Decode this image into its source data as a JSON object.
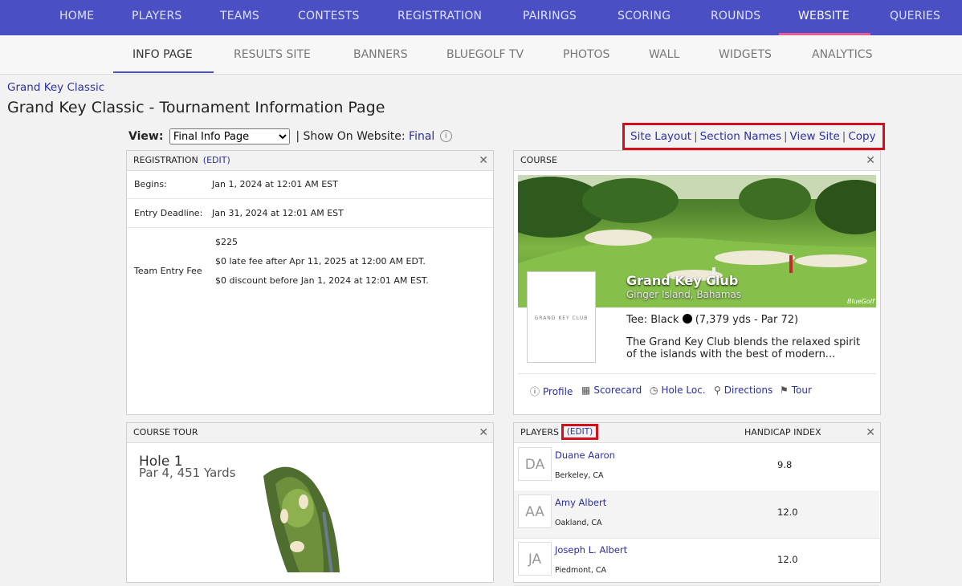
{
  "topnav": {
    "items": [
      "HOME",
      "PLAYERS",
      "TEAMS",
      "CONTESTS",
      "REGISTRATION",
      "PAIRINGS",
      "SCORING",
      "ROUNDS",
      "WEBSITE",
      "QUERIES"
    ],
    "active": "WEBSITE"
  },
  "subnav": {
    "items": [
      "INFO PAGE",
      "RESULTS SITE",
      "BANNERS",
      "BLUEGOLF TV",
      "PHOTOS",
      "WALL",
      "WIDGETS",
      "ANALYTICS"
    ],
    "active": "INFO PAGE"
  },
  "breadcrumb": "Grand Key Classic",
  "page_title": "Grand Key Classic - Tournament Information Page",
  "view": {
    "label": "View:",
    "selected": "Final Info Page",
    "separator": "|",
    "show_label": "Show On Website:",
    "show_value": "Final",
    "info_glyph": "i"
  },
  "actions": [
    "Site Layout",
    "Section Names",
    "View Site",
    "Copy"
  ],
  "action_separator": "|",
  "registration": {
    "title": "REGISTRATION",
    "edit": "(EDIT)",
    "begins_label": "Begins:",
    "begins_value": "Jan 1, 2024 at 12:01 AM EST",
    "deadline_label": "Entry Deadline:",
    "deadline_value": "Jan 31, 2024 at 12:01 AM EST",
    "fee_label": "Team Entry Fee",
    "fee_lines": [
      "$225",
      "$0 late fee after Apr 11, 2025 at 12:00 AM EDT.",
      "$0 discount before Jan 1, 2024 at 12:01 AM EST."
    ]
  },
  "course": {
    "title": "COURSE",
    "club_name": "Grand Key Club",
    "location": "Ginger Island, Bahamas",
    "logo_text": "GRAND KEY CLUB",
    "photo_watermark": "BlueGolf",
    "tee_prefix": "Tee: Black",
    "tee_detail": "(7,379 yds - Par 72)",
    "description": "The Grand Key Club blends the relaxed spirit of the islands with the best of modern...",
    "links": [
      "Profile",
      "Scorecard",
      "Hole Loc.",
      "Directions",
      "Tour"
    ]
  },
  "course_tour": {
    "title": "COURSE TOUR",
    "hole": "Hole 1",
    "hole_detail": "Par 4, 451 Yards"
  },
  "players": {
    "title": "PLAYERS",
    "edit": "(EDIT)",
    "handicap_header": "HANDICAP INDEX",
    "rows": [
      {
        "initials": "DA",
        "name": "Duane Aaron",
        "location": "Berkeley, CA",
        "handicap": "9.8"
      },
      {
        "initials": "AA",
        "name": "Amy Albert",
        "location": "Oakland, CA",
        "handicap": "12.0"
      },
      {
        "initials": "JA",
        "name": "Joseph L. Albert",
        "location": "Piedmont, CA",
        "handicap": "12.0"
      }
    ]
  },
  "colors": {
    "nav_bg": "#4a4fc4",
    "link": "#2b2fa3",
    "highlight": "#d40f1c",
    "active_underline": "#e85c8d"
  }
}
